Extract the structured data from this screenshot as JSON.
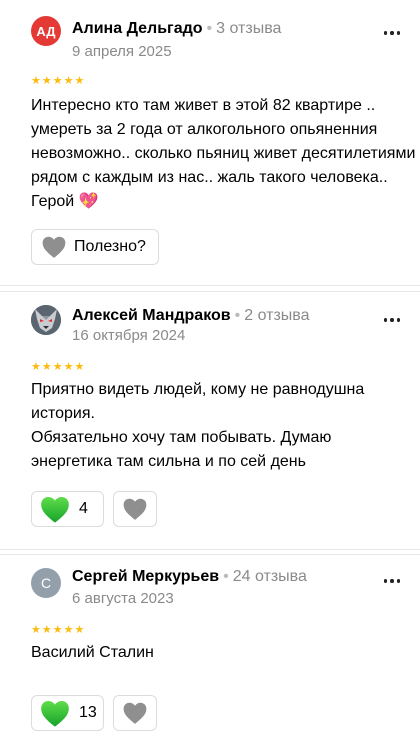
{
  "reviews": [
    {
      "avatar_initials": "АД",
      "author": "Алина Дельгадо",
      "review_count": "3 отзыва",
      "date": "9 апреля 2025",
      "rating": 5,
      "text": "Интересно кто там живет в этой 82 квартире .. умереть за 2 года от алкогольного опьяненния невозможно.. сколько пьяниц живет десятилетиями рядом с каждым из нас.. жаль такого человека.. Герой 💖",
      "useful_label": "Полезно?"
    },
    {
      "avatar_icon": "wolf-avatar",
      "author": "Алексей Мандраков",
      "review_count": "2 отзыва",
      "date": "16 октября 2024",
      "rating": 5,
      "text": "Приятно видеть людей, кому не равнодушна история.\nОбязательно хочу там побывать. Думаю энергетика там сильна и по сей день",
      "likes": "4"
    },
    {
      "avatar_initials": "С",
      "author": "Сергей Меркурьев",
      "review_count": "24 отзыва",
      "date": "6 августа 2023",
      "rating": 5,
      "text": "Василий Сталин",
      "likes": "13"
    }
  ],
  "colors": {
    "star": "#fcbb11",
    "like_heart": "#2eb82e",
    "neutral_heart": "#8f8f8f",
    "avatar_red": "#e53935",
    "avatar_gray": "#93a0ac"
  }
}
